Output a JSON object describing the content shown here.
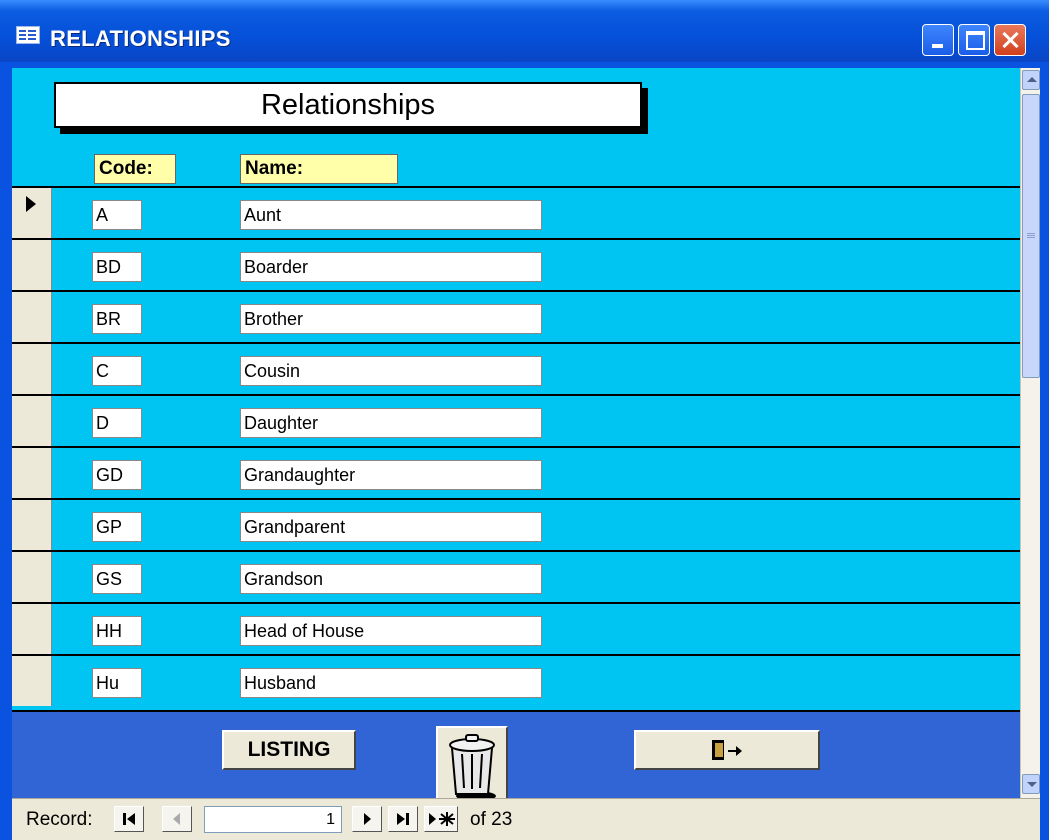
{
  "window": {
    "title": "RELATIONSHIPS"
  },
  "form": {
    "heading": "Relationships",
    "columns": {
      "code": "Code:",
      "name": "Name:"
    },
    "rows": [
      {
        "code": "A",
        "name": "Aunt"
      },
      {
        "code": "BD",
        "name": "Boarder"
      },
      {
        "code": "BR",
        "name": "Brother"
      },
      {
        "code": "C",
        "name": "Cousin"
      },
      {
        "code": "D",
        "name": "Daughter"
      },
      {
        "code": "GD",
        "name": "Grandaughter"
      },
      {
        "code": "GP",
        "name": "Grandparent"
      },
      {
        "code": "GS",
        "name": "Grandson"
      },
      {
        "code": "HH",
        "name": "Head of House"
      },
      {
        "code": "Hu",
        "name": "Husband"
      }
    ]
  },
  "footer": {
    "listing_label": "LISTING"
  },
  "record_nav": {
    "label": "Record:",
    "current": "1",
    "of_text": "of 23"
  },
  "icons": [
    "window-form-icon",
    "trash-can-icon",
    "exit-door-icon",
    "first-record-icon",
    "prev-record-icon",
    "next-record-icon",
    "last-record-icon",
    "new-record-icon"
  ],
  "colors": {
    "form_bg": "#00c4f2",
    "footer_bg": "#3165d6",
    "label_bg": "#ffffaa"
  }
}
